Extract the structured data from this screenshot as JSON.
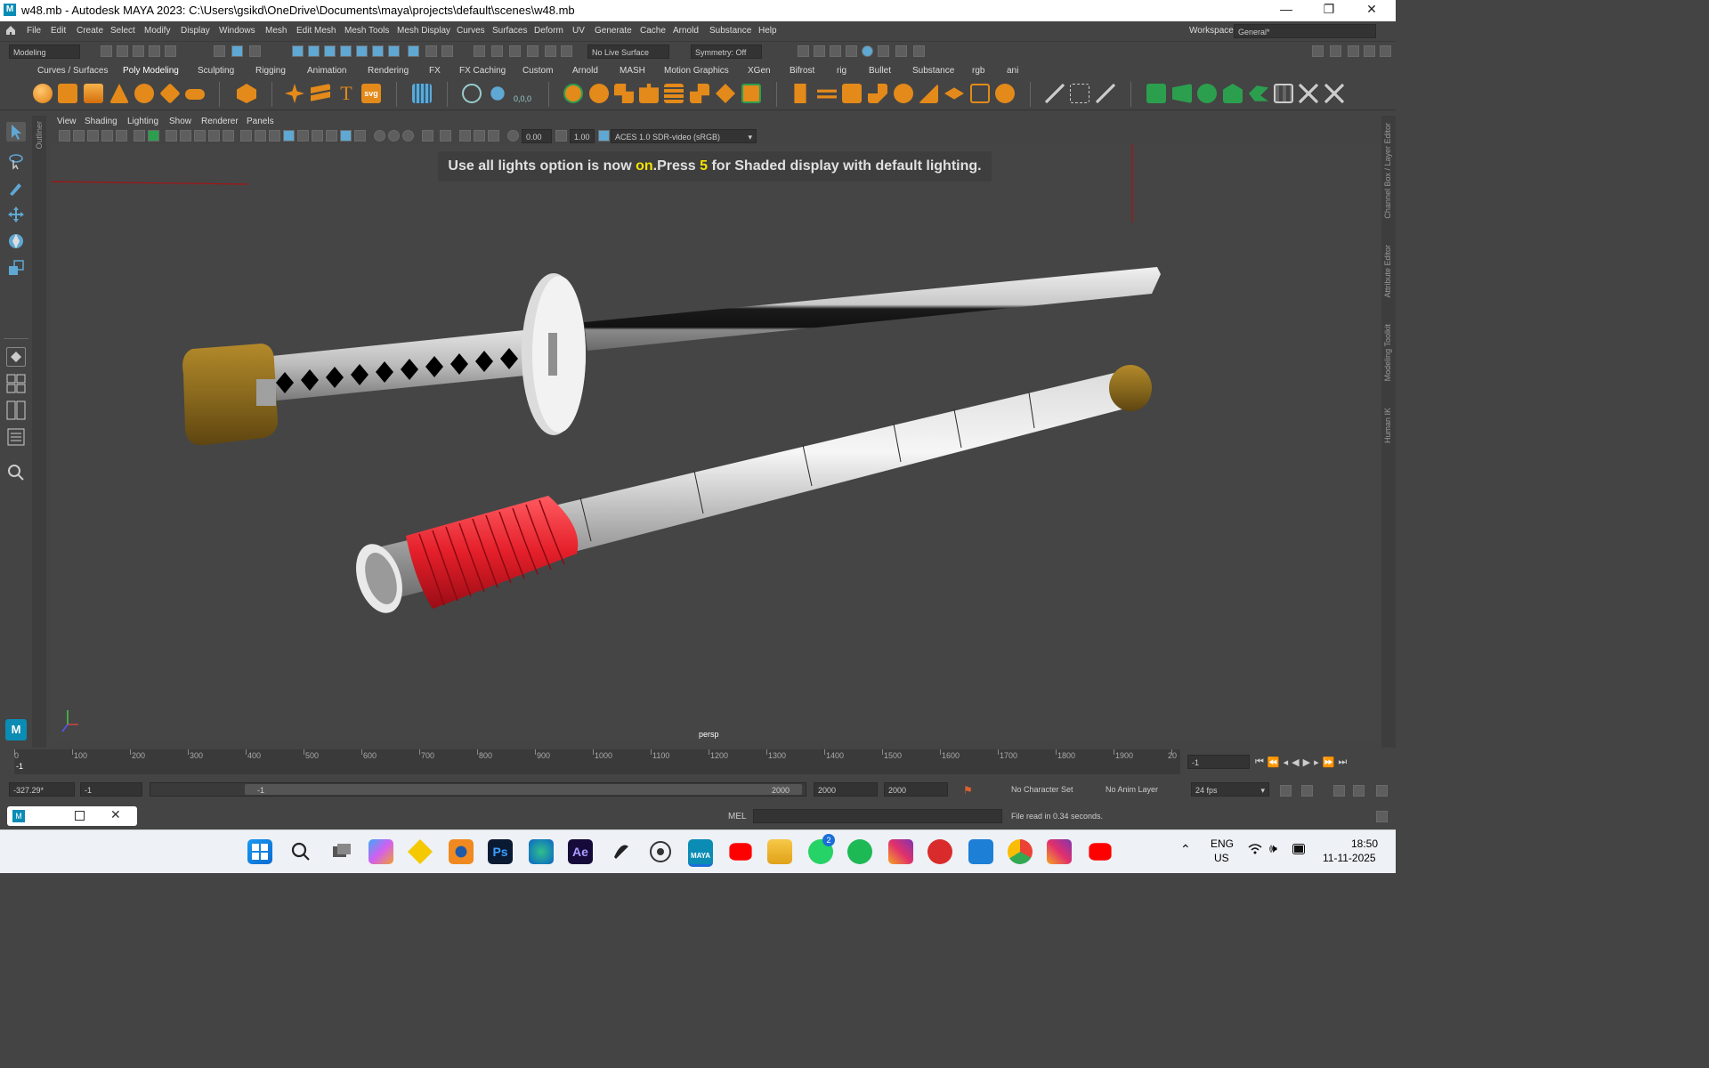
{
  "window": {
    "title": "w48.mb - Autodesk MAYA 2023: C:\\Users\\gsikd\\OneDrive\\Documents\\maya\\projects\\default\\scenes\\w48.mb",
    "logo": "M",
    "minimize": "—",
    "restore": "❐",
    "close": "✕"
  },
  "menubar": {
    "items": [
      "File",
      "Edit",
      "Create",
      "Select",
      "Modify",
      "Display",
      "Windows",
      "Mesh",
      "Edit Mesh",
      "Mesh Tools",
      "Mesh Display",
      "Curves",
      "Surfaces",
      "Deform",
      "UV",
      "Generate",
      "Cache",
      "Arnold",
      "Substance",
      "Help"
    ],
    "workspace_label": "Workspace:",
    "workspace_value": "General*"
  },
  "toolline": {
    "mode": "Modeling",
    "live_surface": "No Live Surface",
    "symmetry": "Symmetry: Off"
  },
  "shelf": {
    "tabs": [
      "Curves / Surfaces",
      "Poly Modeling",
      "Sculpting",
      "Rigging",
      "Animation",
      "Rendering",
      "FX",
      "FX Caching",
      "Custom",
      "Arnold",
      "MASH",
      "Motion Graphics",
      "XGen",
      "Bifrost",
      "rig",
      "Bullet",
      "Substance",
      "rgb",
      "ani"
    ],
    "active_tab": "Poly Modeling",
    "svg_label": "svg",
    "text_label": "T",
    "coords_label": "0,0,0"
  },
  "viewport": {
    "menu": [
      "View",
      "Shading",
      "Lighting",
      "Show",
      "Renderer",
      "Panels"
    ],
    "exposure": "0.00",
    "gamma": "1.00",
    "color_space": "ACES 1.0 SDR-video (sRGB)",
    "hud_prefix": "Use all lights option is now ",
    "hud_on": "on",
    "hud_mid": ".Press ",
    "hud_key": "5",
    "hud_suffix": " for Shaded display with default lighting.",
    "camera": "persp"
  },
  "right_strip": {
    "labels": [
      "Channel Box / Layer Editor",
      "Attribute Editor",
      "Modeling Toolkit",
      "Human IK"
    ]
  },
  "left_strip": {
    "outliner": "Outliner"
  },
  "timeslider": {
    "ticks": [
      "0",
      "100",
      "200",
      "300",
      "400",
      "500",
      "600",
      "700",
      "800",
      "900",
      "1000",
      "1100",
      "1200",
      "1300",
      "1400",
      "1500",
      "1600",
      "1700",
      "1800",
      "1900",
      "20"
    ],
    "current_frame_marker": "-1",
    "current_frame": "-1"
  },
  "rangeline": {
    "field1": "-327.29*",
    "field2": "-1",
    "range_start": "-1",
    "range_end": "2000",
    "end_a": "2000",
    "end_b": "2000",
    "character_set": "No Character Set",
    "anim_layer": "No Anim Layer",
    "fps": "24 fps"
  },
  "cmdline": {
    "lang": "MEL",
    "message": "File read in  0.34 seconds."
  },
  "taskbar": {
    "lang_top": "ENG",
    "lang_bottom": "US",
    "time": "18:50",
    "date": "11-11-2025",
    "whatsapp_badge": "2",
    "maya_label": "MAYA",
    "ps_label": "Ps",
    "ae_label": "Ae"
  },
  "colors": {
    "accent_blue": "#5fa8d3",
    "handle_wrap": "#e41f2a",
    "hud_highlight": "#f5e300",
    "tsuka_gold": "#8a6a1e"
  }
}
